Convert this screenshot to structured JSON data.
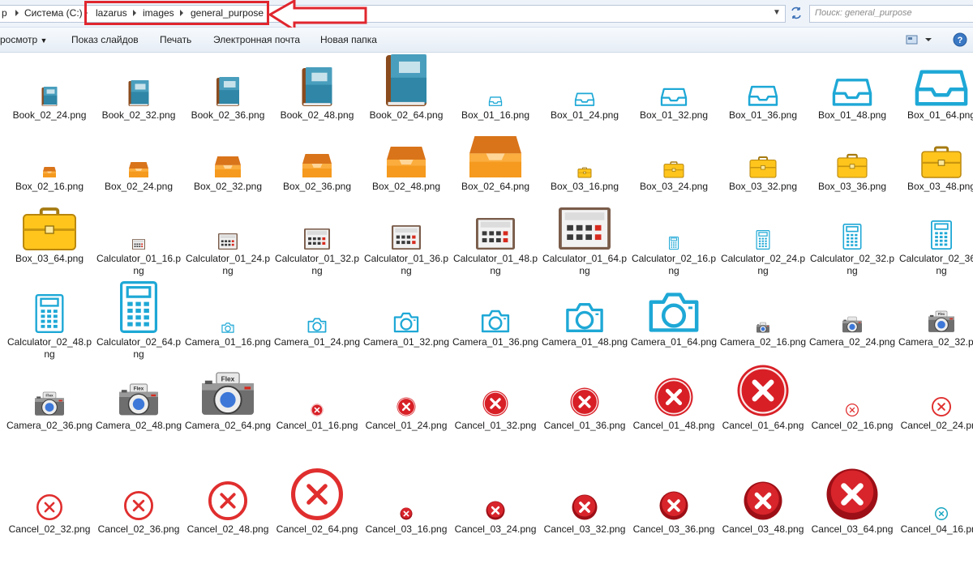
{
  "address_bar": {
    "crumbs": [
      "р",
      "Система (C:)",
      "lazarus",
      "images",
      "general_purpose"
    ],
    "search_placeholder": "Поиск: general_purpose"
  },
  "toolbar": {
    "view_label": "росмотр",
    "slideshow_label": "Показ слайдов",
    "print_label": "Печать",
    "email_label": "Электронная почта",
    "new_folder_label": "Новая папка"
  },
  "files": [
    {
      "name": "Book_02_24.png",
      "icon": "book-icon"
    },
    {
      "name": "Book_02_32.png",
      "icon": "book-icon"
    },
    {
      "name": "Book_02_36.png",
      "icon": "book-icon"
    },
    {
      "name": "Book_02_48.png",
      "icon": "book-icon"
    },
    {
      "name": "Book_02_64.png",
      "icon": "book-icon"
    },
    {
      "name": "Box_01_16.png",
      "icon": "inbox-tray-icon"
    },
    {
      "name": "Box_01_24.png",
      "icon": "inbox-tray-icon"
    },
    {
      "name": "Box_01_32.png",
      "icon": "inbox-tray-icon"
    },
    {
      "name": "Box_01_36.png",
      "icon": "inbox-tray-icon"
    },
    {
      "name": "Box_01_48.png",
      "icon": "inbox-tray-icon"
    },
    {
      "name": "Box_01_64.png",
      "icon": "inbox-tray-icon"
    },
    {
      "name": "Box_02_16.png",
      "icon": "orange-tray-icon"
    },
    {
      "name": "Box_02_24.png",
      "icon": "orange-tray-icon"
    },
    {
      "name": "Box_02_32.png",
      "icon": "orange-tray-icon"
    },
    {
      "name": "Box_02_36.png",
      "icon": "orange-tray-icon"
    },
    {
      "name": "Box_02_48.png",
      "icon": "orange-tray-icon"
    },
    {
      "name": "Box_02_64.png",
      "icon": "orange-tray-icon"
    },
    {
      "name": "Box_03_16.png",
      "icon": "toolbox-icon"
    },
    {
      "name": "Box_03_24.png",
      "icon": "toolbox-icon"
    },
    {
      "name": "Box_03_32.png",
      "icon": "toolbox-icon"
    },
    {
      "name": "Box_03_36.png",
      "icon": "toolbox-icon"
    },
    {
      "name": "Box_03_48.png",
      "icon": "toolbox-icon"
    },
    {
      "name": "Box_03_64.png",
      "icon": "toolbox-icon"
    },
    {
      "name": "Calculator_01_16.png",
      "icon": "calculator-icon"
    },
    {
      "name": "Calculator_01_24.png",
      "icon": "calculator-icon"
    },
    {
      "name": "Calculator_01_32.png",
      "icon": "calculator-icon"
    },
    {
      "name": "Calculator_01_36.png",
      "icon": "calculator-icon"
    },
    {
      "name": "Calculator_01_48.png",
      "icon": "calculator-icon"
    },
    {
      "name": "Calculator_01_64.png",
      "icon": "calculator-icon"
    },
    {
      "name": "Calculator_02_16.png",
      "icon": "calculator-outline-icon"
    },
    {
      "name": "Calculator_02_24.png",
      "icon": "calculator-outline-icon"
    },
    {
      "name": "Calculator_02_32.png",
      "icon": "calculator-outline-icon"
    },
    {
      "name": "Calculator_02_36.png",
      "icon": "calculator-outline-icon"
    },
    {
      "name": "Calculator_02_48.png",
      "icon": "calculator-outline-icon"
    },
    {
      "name": "Calculator_02_64.png",
      "icon": "calculator-outline-icon"
    },
    {
      "name": "Camera_01_16.png",
      "icon": "camera-outline-icon"
    },
    {
      "name": "Camera_01_24.png",
      "icon": "camera-outline-icon"
    },
    {
      "name": "Camera_01_32.png",
      "icon": "camera-outline-icon"
    },
    {
      "name": "Camera_01_36.png",
      "icon": "camera-outline-icon"
    },
    {
      "name": "Camera_01_48.png",
      "icon": "camera-outline-icon"
    },
    {
      "name": "Camera_01_64.png",
      "icon": "camera-outline-icon"
    },
    {
      "name": "Camera_02_16.png",
      "icon": "camera-icon"
    },
    {
      "name": "Camera_02_24.png",
      "icon": "camera-icon"
    },
    {
      "name": "Camera_02_32.png",
      "icon": "camera-icon"
    },
    {
      "name": "Camera_02_36.png",
      "icon": "camera-icon"
    },
    {
      "name": "Camera_02_48.png",
      "icon": "camera-icon"
    },
    {
      "name": "Camera_02_64.png",
      "icon": "camera-icon"
    },
    {
      "name": "Cancel_01_16.png",
      "icon": "cancel-filled-icon"
    },
    {
      "name": "Cancel_01_24.png",
      "icon": "cancel-filled-icon"
    },
    {
      "name": "Cancel_01_32.png",
      "icon": "cancel-filled-icon"
    },
    {
      "name": "Cancel_01_36.png",
      "icon": "cancel-filled-icon"
    },
    {
      "name": "Cancel_01_48.png",
      "icon": "cancel-filled-icon"
    },
    {
      "name": "Cancel_01_64.png",
      "icon": "cancel-filled-icon"
    },
    {
      "name": "Cancel_02_16.png",
      "icon": "cancel-outline-icon"
    },
    {
      "name": "Cancel_02_24.png",
      "icon": "cancel-outline-icon"
    },
    {
      "name": "Cancel_02_32.png",
      "icon": "cancel-outline-icon"
    },
    {
      "name": "Cancel_02_36.png",
      "icon": "cancel-outline-icon"
    },
    {
      "name": "Cancel_02_48.png",
      "icon": "cancel-outline-icon"
    },
    {
      "name": "Cancel_02_64.png",
      "icon": "cancel-outline-icon"
    },
    {
      "name": "Cancel_03_16.png",
      "icon": "cancel-dark-icon"
    },
    {
      "name": "Cancel_03_24.png",
      "icon": "cancel-dark-icon"
    },
    {
      "name": "Cancel_03_32.png",
      "icon": "cancel-dark-icon"
    },
    {
      "name": "Cancel_03_36.png",
      "icon": "cancel-dark-icon"
    },
    {
      "name": "Cancel_03_48.png",
      "icon": "cancel-dark-icon"
    },
    {
      "name": "Cancel_03_64.png",
      "icon": "cancel-dark-icon"
    },
    {
      "name": "Cancel_04_16.png",
      "icon": "cancel-teal-icon"
    }
  ],
  "colors": {
    "highlight": "#e0262e",
    "book_blue": "#2f86a6",
    "tray_blue": "#1ea8d6",
    "orange": "#f59a1e",
    "yellow": "#ffc51c",
    "red": "#d81f26",
    "teal": "#17a6c0"
  }
}
